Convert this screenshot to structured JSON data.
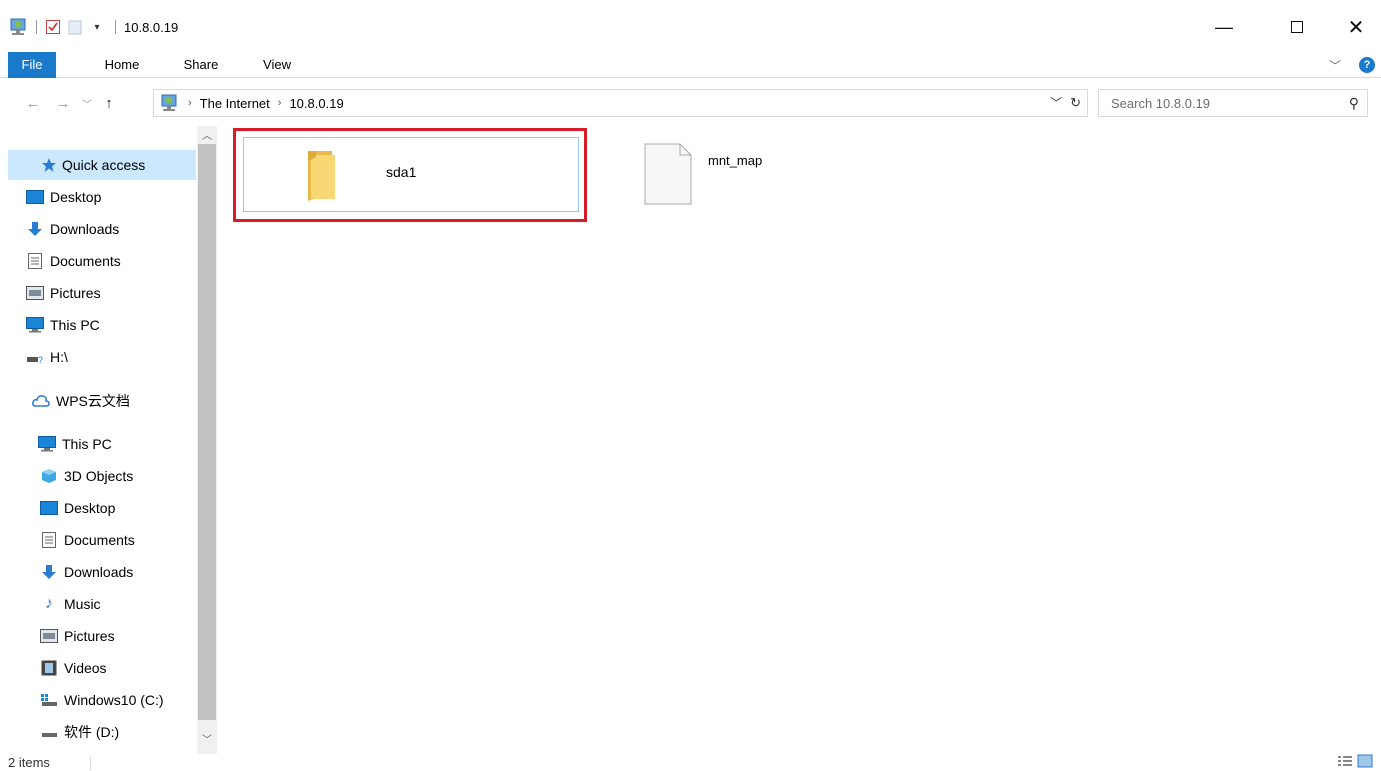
{
  "window": {
    "title": "10.8.0.19",
    "qat_icons": [
      "network-location-icon",
      "properties-check-icon",
      "new-folder-icon",
      "customize-dropdown-icon"
    ]
  },
  "ribbon": {
    "tabs": [
      "File",
      "Home",
      "Share",
      "View"
    ]
  },
  "address": {
    "root_icon": "network-location-icon",
    "crumbs": [
      "The Internet",
      "10.8.0.19"
    ],
    "search_placeholder": "Search 10.8.0.19"
  },
  "navpane": {
    "quick_access": {
      "label": "Quick access",
      "icon": "star-icon"
    },
    "pinned": [
      {
        "label": "Desktop",
        "icon": "desktop-icon"
      },
      {
        "label": "Downloads",
        "icon": "downloads-icon"
      },
      {
        "label": "Documents",
        "icon": "documents-icon"
      },
      {
        "label": "Pictures",
        "icon": "pictures-icon"
      },
      {
        "label": "This PC",
        "icon": "monitor-icon"
      },
      {
        "label": "H:\\",
        "icon": "network-drive-icon"
      }
    ],
    "wps": {
      "label": "WPS云文档",
      "icon": "cloud-icon"
    },
    "this_pc": {
      "label": "This PC",
      "icon": "monitor-icon"
    },
    "this_pc_children": [
      {
        "label": "3D Objects",
        "icon": "cube-icon"
      },
      {
        "label": "Desktop",
        "icon": "desktop-icon"
      },
      {
        "label": "Documents",
        "icon": "documents-icon"
      },
      {
        "label": "Downloads",
        "icon": "downloads-icon"
      },
      {
        "label": "Music",
        "icon": "music-note-icon"
      },
      {
        "label": "Pictures",
        "icon": "pictures-icon"
      },
      {
        "label": "Videos",
        "icon": "videos-icon"
      },
      {
        "label": "Windows10 (C:)",
        "icon": "windows-drive-icon"
      },
      {
        "label": "软件 (D:)",
        "icon": "drive-icon"
      }
    ]
  },
  "content": {
    "items": [
      {
        "name": "sda1",
        "type": "folder",
        "selected": true
      },
      {
        "name": "mnt_map",
        "type": "file",
        "selected": false
      }
    ]
  },
  "status": {
    "item_count": "2 items"
  },
  "colors": {
    "accent": "#1979ca",
    "selection": "#cce8ff",
    "highlight_border": "#d81b28",
    "folder": "#f8d775"
  }
}
